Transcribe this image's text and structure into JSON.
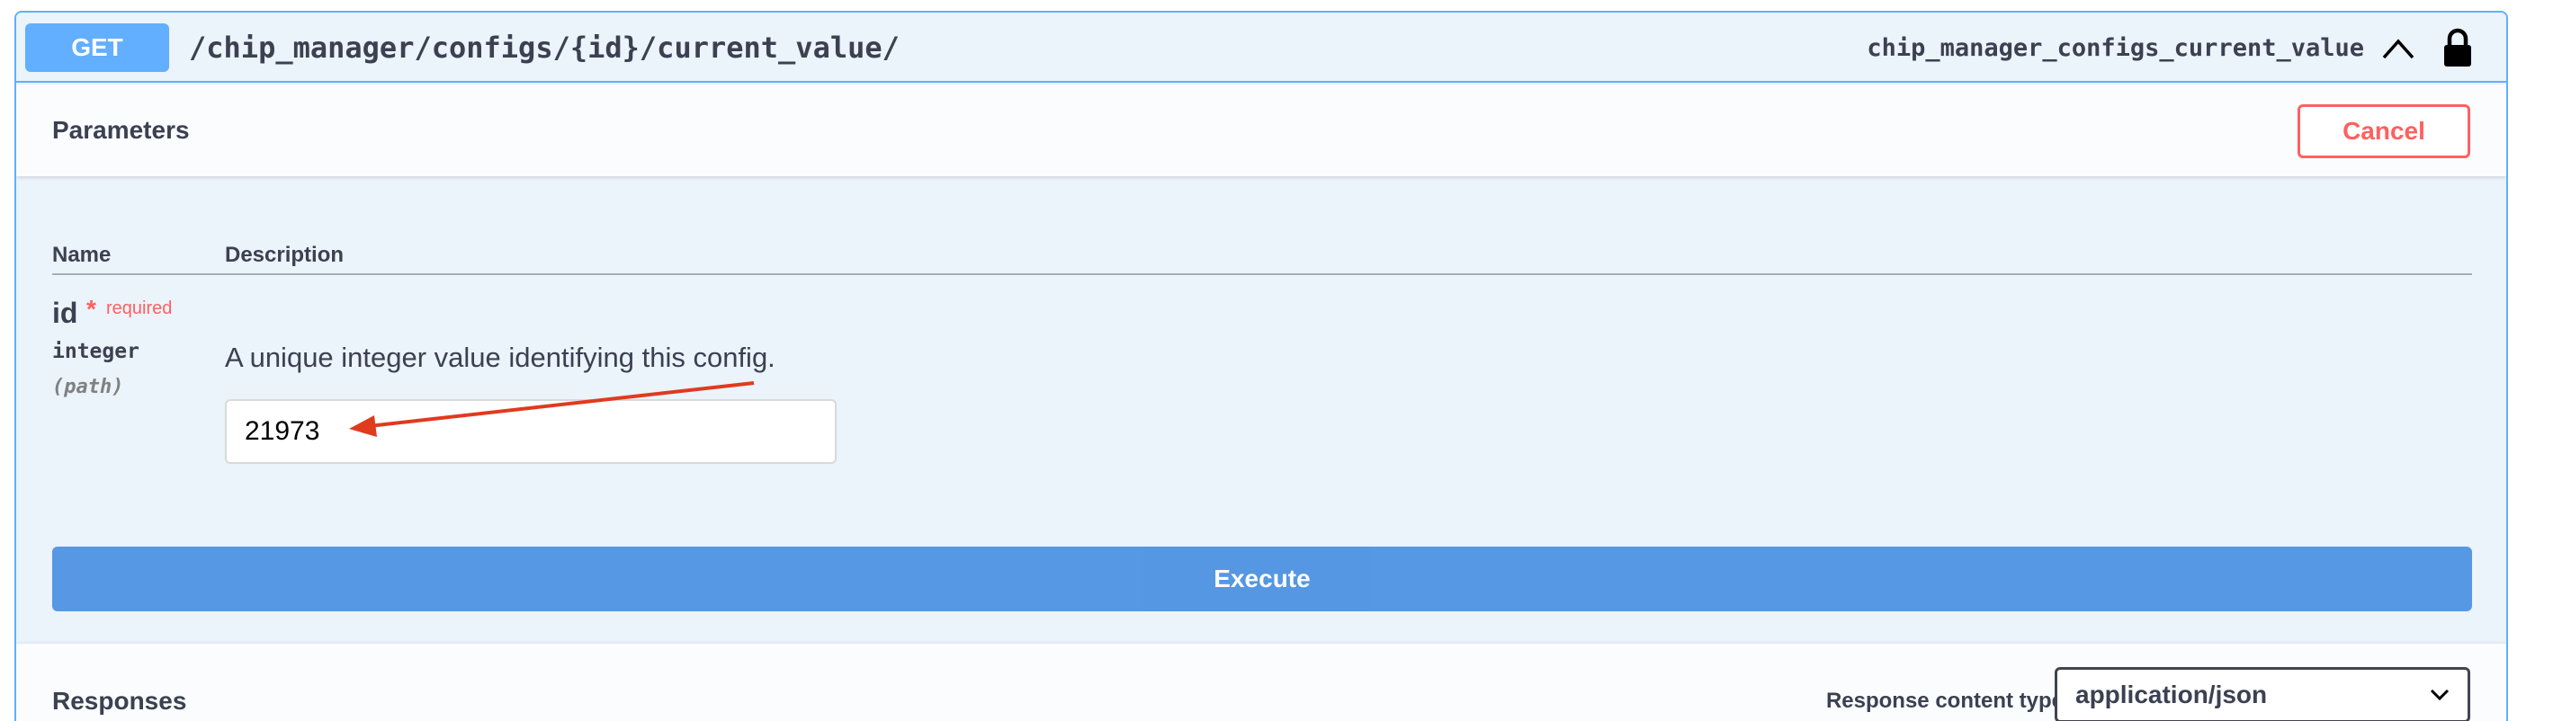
{
  "operation": {
    "method": "GET",
    "path": "/chip_manager/configs/{id}/current_value/",
    "operation_id": "chip_manager_configs_current_value"
  },
  "parameters": {
    "title": "Parameters",
    "cancel_label": "Cancel",
    "columns": {
      "name": "Name",
      "description": "Description"
    },
    "items": [
      {
        "name": "id",
        "required_star": "*",
        "required_label": "required",
        "type": "integer",
        "location": "(path)",
        "description": "A unique integer value identifying this config.",
        "value": "21973"
      }
    ]
  },
  "execute_label": "Execute",
  "responses": {
    "title": "Responses",
    "content_type_label": "Response content type",
    "content_type_value": "application/json"
  },
  "colors": {
    "get_accent": "#61affe",
    "danger": "#ff6060",
    "execute": "#4990e2",
    "annotation_arrow": "#e03a1f"
  },
  "icons": [
    "chevron-up-icon",
    "lock-icon",
    "chevron-down-icon"
  ]
}
